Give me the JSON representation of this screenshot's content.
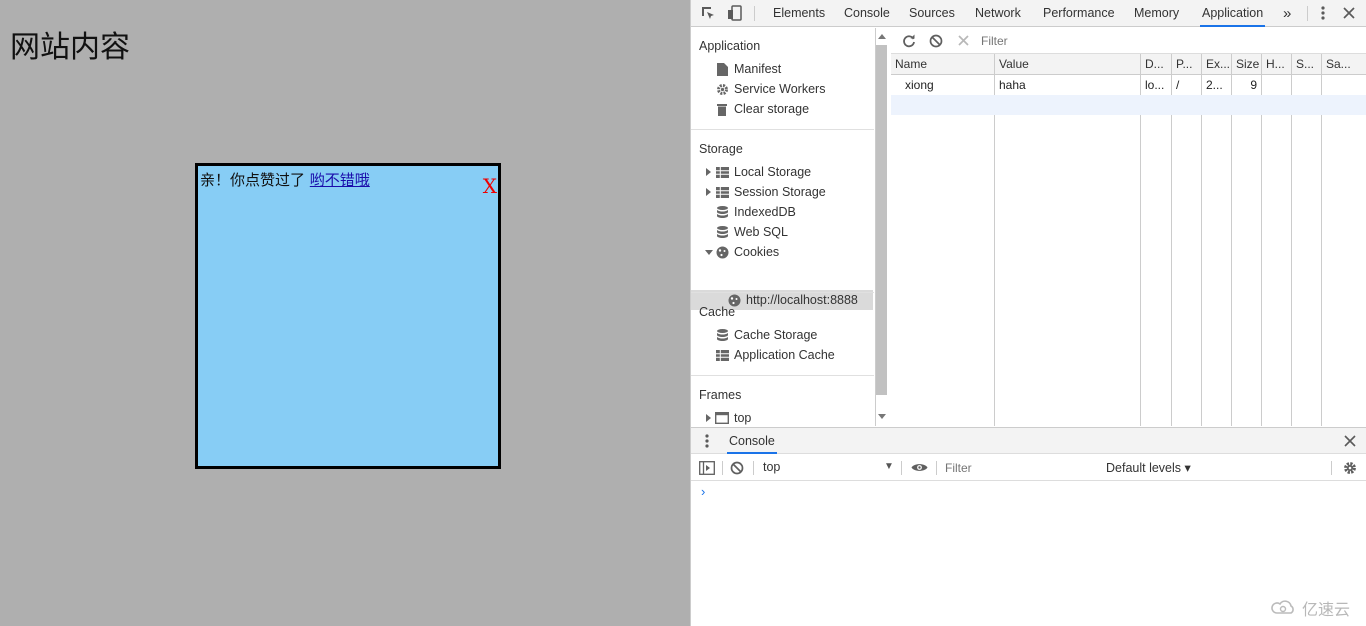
{
  "page": {
    "title": "网站内容",
    "popup": {
      "text": "亲！你点赞过了",
      "link": "哟不错哦",
      "close": "X"
    }
  },
  "devtools": {
    "tabs": [
      "Elements",
      "Console",
      "Sources",
      "Network",
      "Performance",
      "Memory",
      "Application"
    ],
    "active_tab": "Application",
    "more_tabs": "»",
    "sidebar": {
      "application_title": "Application",
      "application_items": [
        "Manifest",
        "Service Workers",
        "Clear storage"
      ],
      "storage_title": "Storage",
      "storage_items": [
        "Local Storage",
        "Session Storage",
        "IndexedDB",
        "Web SQL",
        "Cookies"
      ],
      "cookie_origin": "http://localhost:8888",
      "cache_title": "Cache",
      "cache_items": [
        "Cache Storage",
        "Application Cache"
      ],
      "frames_title": "Frames",
      "frames_items": [
        "top"
      ]
    },
    "cookies": {
      "filter_placeholder": "Filter",
      "columns": [
        "Name",
        "Value",
        "D...",
        "P...",
        "Ex...",
        "Size",
        "H...",
        "S...",
        "Sa..."
      ],
      "rows": [
        {
          "name": "xiong",
          "value": "haha",
          "domain": "lo...",
          "path": "/",
          "expires": "2...",
          "size": "9"
        }
      ]
    },
    "drawer": {
      "tab": "Console",
      "context": "top",
      "filter_placeholder": "Filter",
      "levels": "Default levels ▾",
      "prompt": "›"
    }
  },
  "watermark": "亿速云",
  "colors": {
    "page_bg": "#afafaf",
    "popup_bg": "#87cdf5",
    "close_red": "#ee0000",
    "accent": "#1a73e8"
  }
}
